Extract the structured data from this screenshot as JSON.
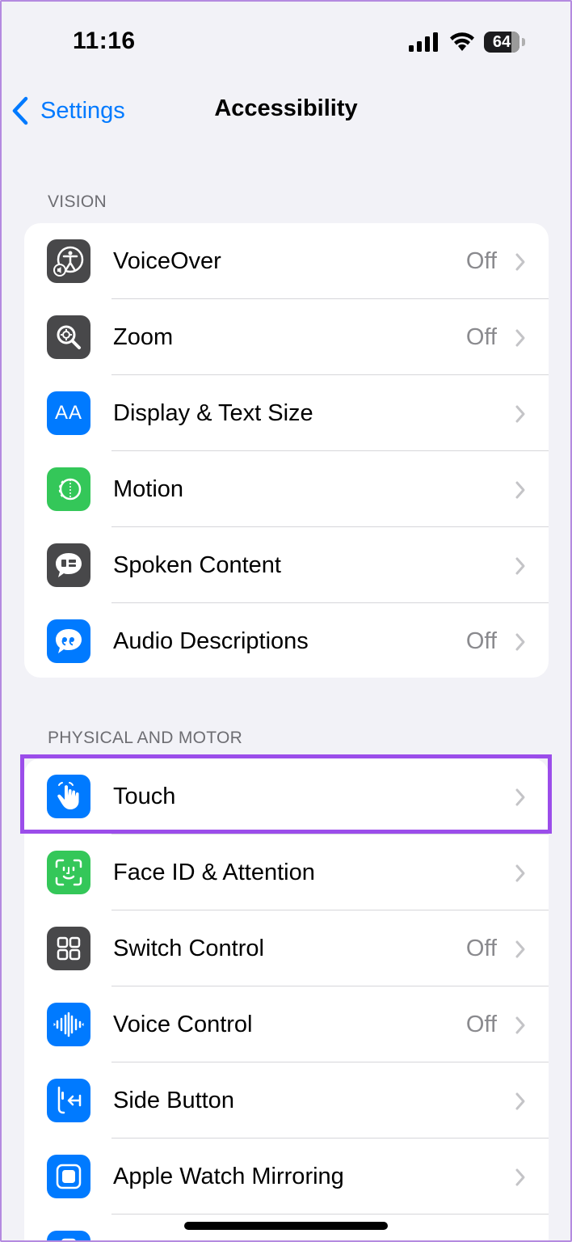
{
  "status": {
    "time": "11:16",
    "battery": "64"
  },
  "nav": {
    "back_label": "Settings",
    "title": "Accessibility"
  },
  "sections": [
    {
      "header": "VISION",
      "items": [
        {
          "label": "VoiceOver",
          "value": "Off",
          "icon": "voiceover-icon",
          "color": "#48484a"
        },
        {
          "label": "Zoom",
          "value": "Off",
          "icon": "zoom-icon",
          "color": "#48484a"
        },
        {
          "label": "Display & Text Size",
          "value": "",
          "icon": "text-size-icon",
          "color": "#007aff"
        },
        {
          "label": "Motion",
          "value": "",
          "icon": "motion-icon",
          "color": "#34c759"
        },
        {
          "label": "Spoken Content",
          "value": "",
          "icon": "speech-bubble-icon",
          "color": "#48484a"
        },
        {
          "label": "Audio Descriptions",
          "value": "Off",
          "icon": "quote-bubble-icon",
          "color": "#007aff"
        }
      ]
    },
    {
      "header": "PHYSICAL AND MOTOR",
      "items": [
        {
          "label": "Touch",
          "value": "",
          "icon": "hand-pointer-icon",
          "color": "#007aff"
        },
        {
          "label": "Face ID & Attention",
          "value": "",
          "icon": "face-id-icon",
          "color": "#34c759"
        },
        {
          "label": "Switch Control",
          "value": "Off",
          "icon": "grid-icon",
          "color": "#48484a"
        },
        {
          "label": "Voice Control",
          "value": "Off",
          "icon": "waveform-icon",
          "color": "#007aff"
        },
        {
          "label": "Side Button",
          "value": "",
          "icon": "side-button-icon",
          "color": "#007aff"
        },
        {
          "label": "Apple Watch Mirroring",
          "value": "",
          "icon": "watch-icon",
          "color": "#007aff"
        }
      ]
    }
  ],
  "colors": {
    "accent": "#007aff",
    "highlight": "#9b4dea"
  }
}
